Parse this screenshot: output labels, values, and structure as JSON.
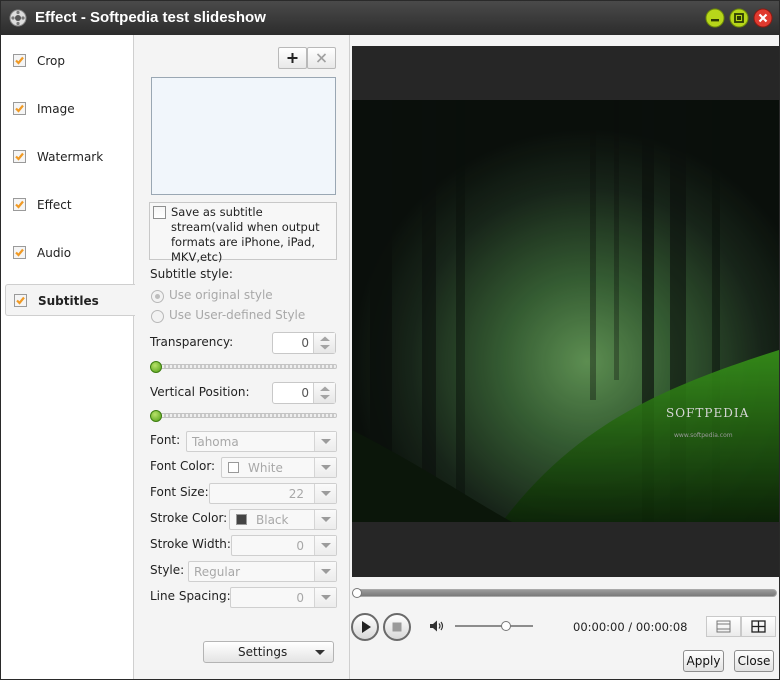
{
  "window": {
    "title": "Effect - Softpedia test slideshow"
  },
  "nav": {
    "items": [
      {
        "label": "Crop",
        "checked": true
      },
      {
        "label": "Image",
        "checked": true
      },
      {
        "label": "Watermark",
        "checked": true
      },
      {
        "label": "Effect",
        "checked": true
      },
      {
        "label": "Audio",
        "checked": true
      },
      {
        "label": "Subtitles",
        "checked": true,
        "active": true
      }
    ]
  },
  "subtitles": {
    "save_stream_label": "Save as subtitle stream(valid when output formats are iPhone, iPad, MKV,etc)",
    "save_stream_checked": false,
    "style_heading": "Subtitle style:",
    "style_options": [
      "Use original style",
      "Use User-defined Style"
    ],
    "transparency_label": "Transparency:",
    "transparency_value": "0",
    "vertical_label": "Vertical Position:",
    "vertical_value": "0",
    "font_label": "Font:",
    "font_value": "Tahoma",
    "font_color_label": "Font Color:",
    "font_color_value": "White",
    "font_size_label": "Font Size:",
    "font_size_value": "22",
    "stroke_color_label": "Stroke Color:",
    "stroke_color_value": "Black",
    "stroke_width_label": "Stroke Width:",
    "stroke_width_value": "0",
    "style_label": "Style:",
    "style_value": "Regular",
    "line_spacing_label": "Line Spacing:",
    "line_spacing_value": "0",
    "settings_label": "Settings"
  },
  "preview": {
    "watermark_text": "SOFTPEDIA",
    "watermark_url": "www.softpedia.com"
  },
  "player": {
    "time": "00:00:00 / 00:00:08",
    "progress": 0,
    "volume": 0.65
  },
  "buttons": {
    "apply": "Apply",
    "close": "Close"
  },
  "colors": {
    "accent_check": "#f09a25",
    "slider_knob": "#6cc21c",
    "close_button": "#e03a2f",
    "min_button": "#b7d61a"
  },
  "icons": [
    "app-icon",
    "minimize-icon",
    "maximize-icon",
    "close-icon",
    "add-icon",
    "remove-icon",
    "play-icon",
    "stop-icon",
    "volume-icon",
    "view-single-icon",
    "view-split-icon"
  ]
}
